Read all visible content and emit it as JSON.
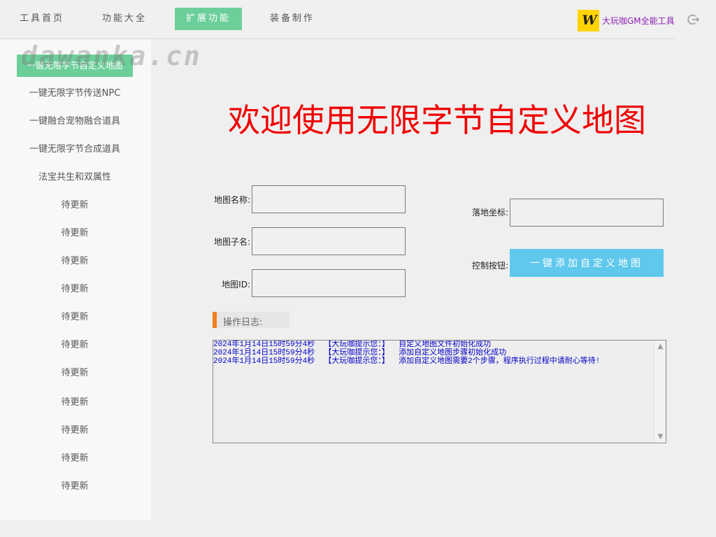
{
  "nav": {
    "tabs": [
      {
        "label": "工具首页",
        "active": false
      },
      {
        "label": "功能大全",
        "active": false
      },
      {
        "label": "扩展功能",
        "active": true
      },
      {
        "label": "装备制作",
        "active": false
      }
    ],
    "brand_text": "大玩咖GM全能工具",
    "brand_logo": "W",
    "logout_icon": "logout-icon"
  },
  "watermark": "dawanka.cn",
  "sidebar": {
    "items": [
      {
        "label": "一键无限字节自定义地图",
        "active": true
      },
      {
        "label": "一键无限字节传送NPC"
      },
      {
        "label": "一键融合宠物融合道具"
      },
      {
        "label": "一键无限字节合成道具"
      },
      {
        "label": "法宝共生和双属性"
      },
      {
        "label": "待更新"
      },
      {
        "label": "待更新"
      },
      {
        "label": "待更新"
      },
      {
        "label": "待更新"
      },
      {
        "label": "待更新"
      },
      {
        "label": "待更新"
      },
      {
        "label": "待更新"
      },
      {
        "label": "待更新"
      },
      {
        "label": "待更新"
      },
      {
        "label": "待更新"
      },
      {
        "label": "待更新"
      }
    ]
  },
  "main": {
    "title": "欢迎使用无限字节自定义地图",
    "fields": {
      "map_name_label": "地图名称:",
      "map_name_value": "",
      "map_subname_label": "地图子名:",
      "map_subname_value": "",
      "map_id_label": "地图ID:",
      "map_id_value": "",
      "landing_coord_label": "落地坐标:",
      "landing_coord_value": "",
      "control_label": "控制按钮:"
    },
    "action_button": "一键添加自定义地图",
    "log_title": "操作日志:",
    "log_lines": [
      "2024年1月14日15时59分4秒  【大玩咖提示您：】  自定义地图文件初始化成功",
      "2024年1月14日15时59分4秒  【大玩咖提示您：】  添加自定义地图步骤初始化成功",
      "2024年1月14日15时59分4秒  【大玩咖提示您：】  添加自定义地图需要2个步骤，程序执行过程中请耐心等待!"
    ]
  },
  "colors": {
    "accent_green": "#6ccf9a",
    "button_blue": "#5fc8ec",
    "title_red": "#f00000",
    "log_blue": "#0000c8",
    "log_marker_orange": "#f07f1f",
    "brand_purple": "#8a1fb5",
    "brand_yellow": "#ffd400"
  }
}
